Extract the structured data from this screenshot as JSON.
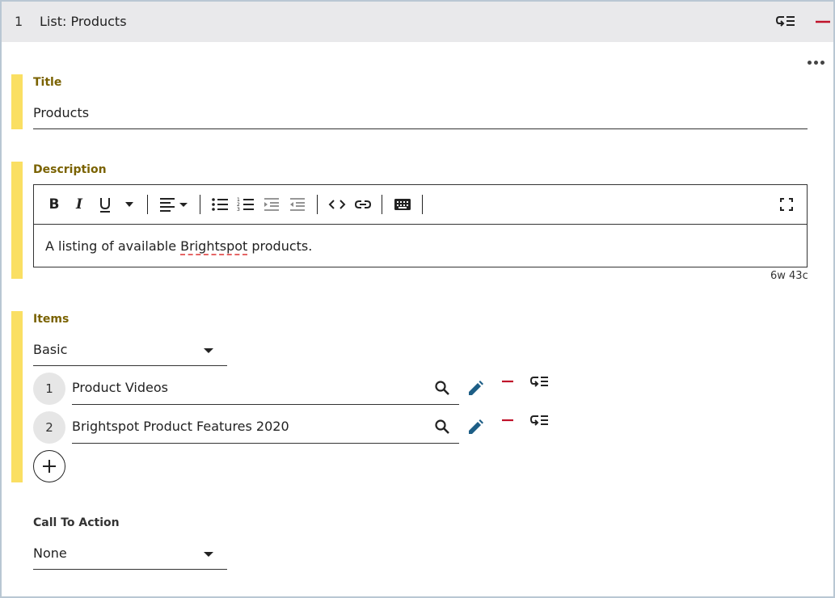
{
  "header": {
    "number": "1",
    "title": "List: Products"
  },
  "fields": {
    "title": {
      "label": "Title",
      "value": "Products"
    },
    "description": {
      "label": "Description",
      "text_before": "A listing of available ",
      "text_spell": "Brightspot",
      "text_after": " products.",
      "counter": "6w 43c"
    },
    "items": {
      "label": "Items",
      "type_selected": "Basic",
      "rows": [
        {
          "index": "1",
          "value": "Product Videos"
        },
        {
          "index": "2",
          "value": "Brightspot Product Features 2020"
        }
      ]
    },
    "cta": {
      "label": "Call To Action",
      "selected": "None"
    }
  },
  "colors": {
    "accent_bar": "#fadf63",
    "label_gold": "#7a6200",
    "remove_red": "#c0122a",
    "edit_blue": "#1d5e86",
    "header_bg": "#e9e9eb"
  },
  "toolbar": {
    "buttons": [
      "bold-icon",
      "italic-icon",
      "underline-icon",
      "more-formats-icon",
      "align-icon",
      "bulleted-list-icon",
      "numbered-list-icon",
      "indent-icon",
      "outdent-icon",
      "code-icon",
      "link-icon",
      "keyboard-icon",
      "fullscreen-icon"
    ]
  }
}
